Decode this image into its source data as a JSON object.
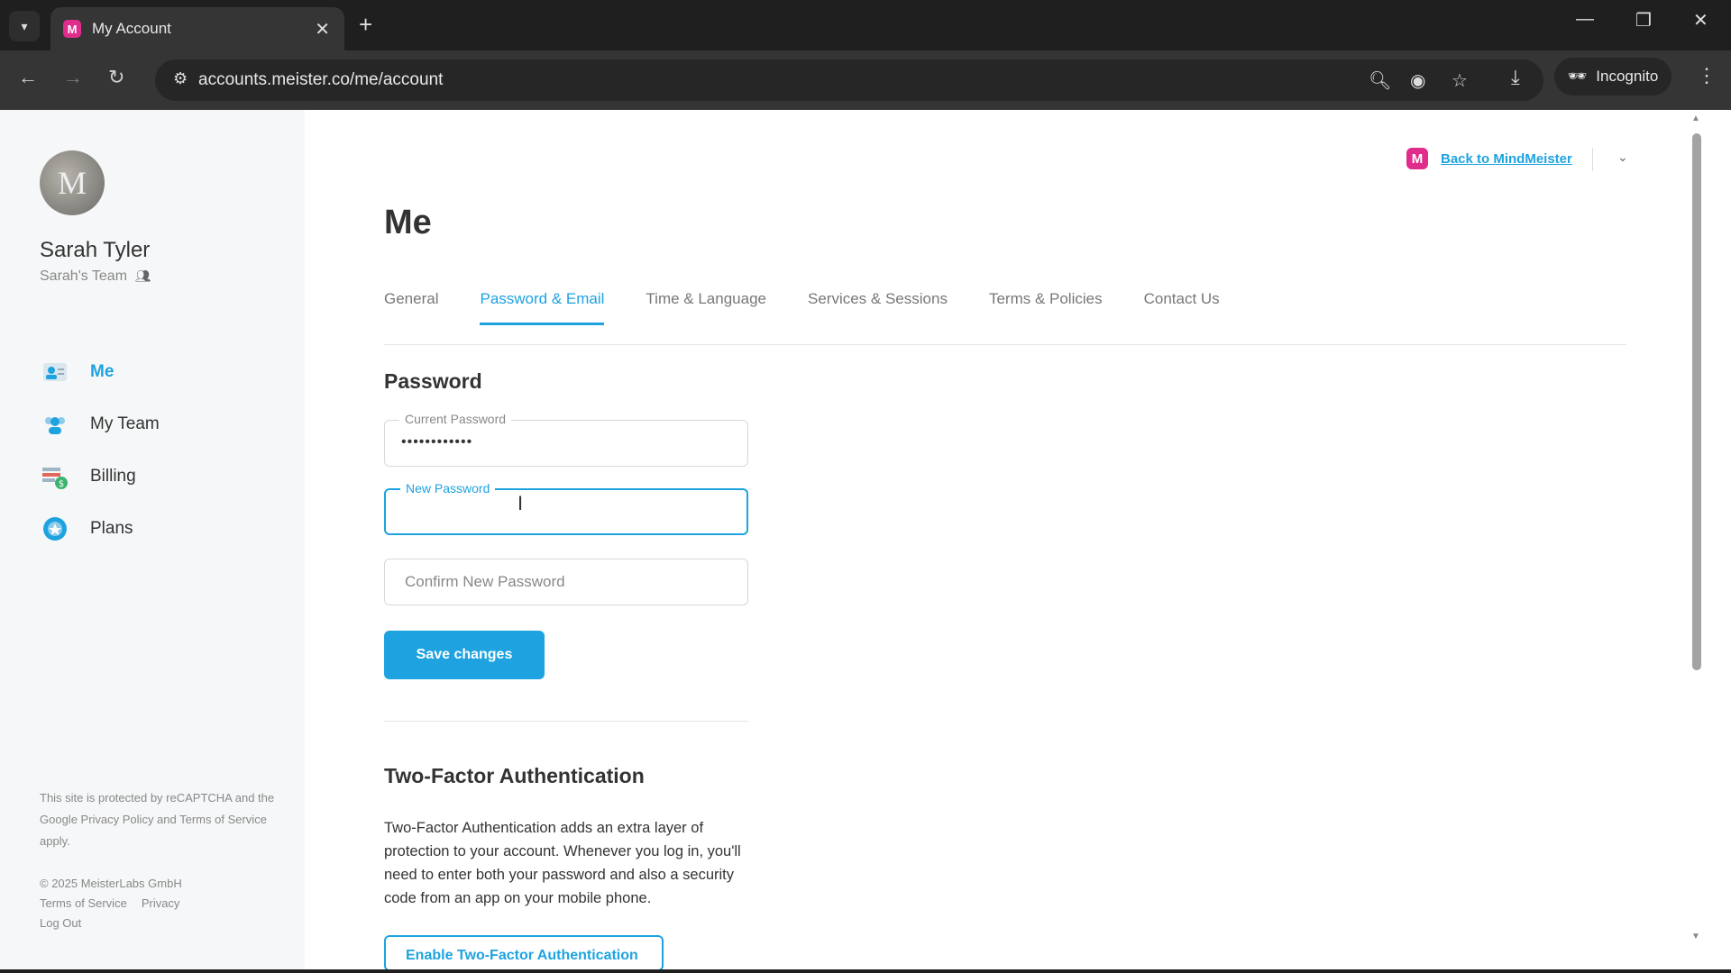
{
  "browser": {
    "tab_title": "My Account",
    "tab_favicon_letter": "M",
    "url": "accounts.meister.co/me/account",
    "incognito_label": "Incognito"
  },
  "sidebar": {
    "avatar_letter": "M",
    "user_name": "Sarah Tyler",
    "team_name": "Sarah's Team",
    "items": [
      {
        "label": "Me",
        "icon": "user-card-icon",
        "active": true
      },
      {
        "label": "My Team",
        "icon": "team-icon",
        "active": false
      },
      {
        "label": "Billing",
        "icon": "billing-icon",
        "active": false
      },
      {
        "label": "Plans",
        "icon": "plans-badge-icon",
        "active": false
      }
    ],
    "legal": "This site is protected by reCAPTCHA and the Google Privacy Policy and Terms of Service apply.",
    "copyright": "© 2025 MeisterLabs GmbH",
    "terms": "Terms of Service",
    "privacy": "Privacy",
    "logout": "Log Out"
  },
  "header": {
    "back_link": "Back to MindMeister",
    "back_logo_letter": "M",
    "page_title": "Me"
  },
  "tabs": [
    {
      "label": "General",
      "active": false
    },
    {
      "label": "Password & Email",
      "active": true
    },
    {
      "label": "Time & Language",
      "active": false
    },
    {
      "label": "Services & Sessions",
      "active": false
    },
    {
      "label": "Terms & Policies",
      "active": false
    },
    {
      "label": "Contact Us",
      "active": false
    }
  ],
  "password": {
    "title": "Password",
    "current_label": "Current Password",
    "current_value": "••••••••••••",
    "new_label": "New Password",
    "new_value": "",
    "confirm_placeholder": "Confirm New Password",
    "save_label": "Save changes"
  },
  "two_factor": {
    "title": "Two-Factor Authentication",
    "description": "Two-Factor Authentication adds an extra layer of protection to your account. Whenever you log in, you'll need to enter both your password and also a security code from an app on your mobile phone.",
    "button_label": "Enable Two-Factor Authentication"
  },
  "colors": {
    "accent": "#1ea3e0",
    "brand": "#e02c8b"
  }
}
